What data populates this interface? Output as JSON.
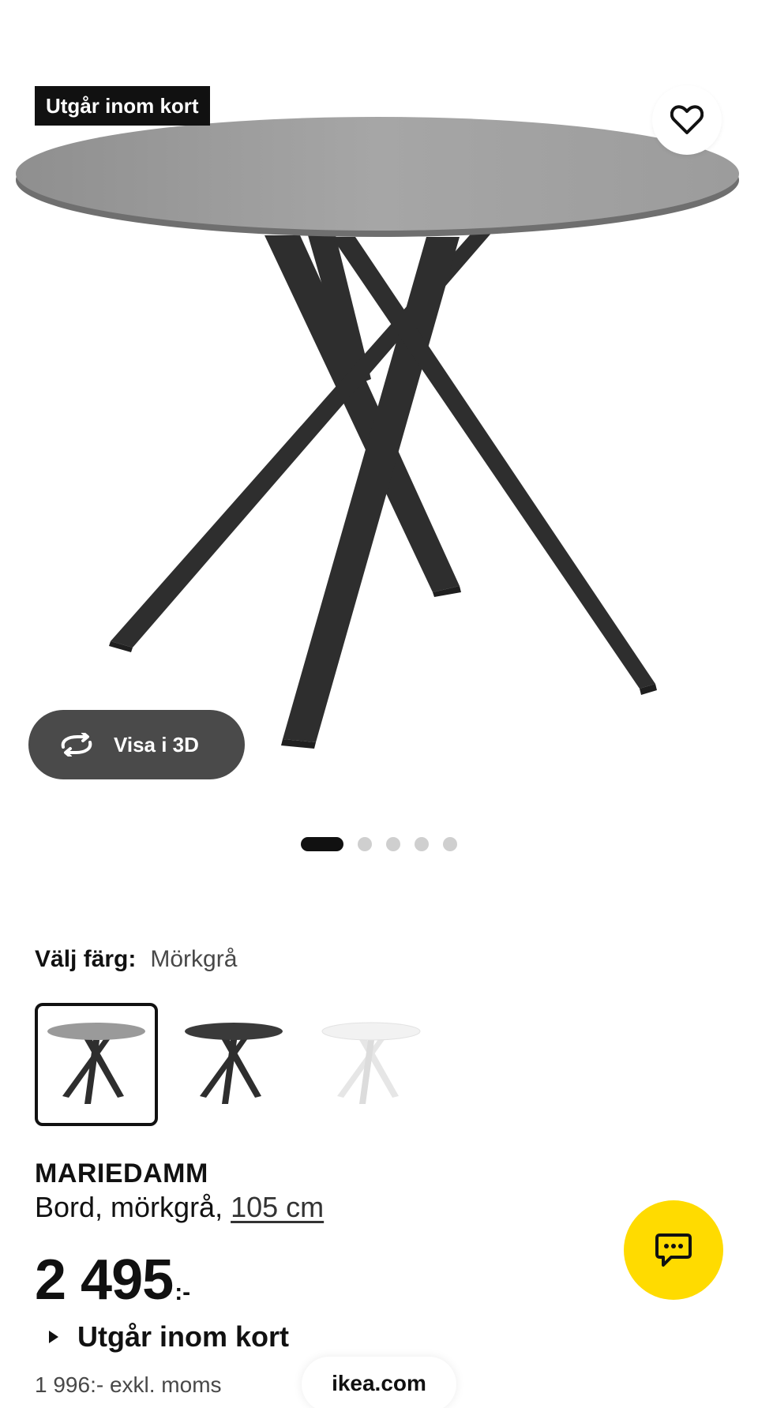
{
  "product_image": {
    "badge": "Utgår inom kort",
    "view_3d_label": "Visa i 3D",
    "carousel": {
      "total": 5,
      "active_index": 0
    }
  },
  "color": {
    "label": "Välj färg:",
    "selected": "Mörkgrå",
    "swatch_colors": [
      "#9a9a9a",
      "#3a3a3a",
      "#f2f2f2"
    ]
  },
  "product": {
    "name": "MARIEDAMM",
    "description": "Bord, mörkgrå, ",
    "size": "105 cm",
    "price": "2 495",
    "price_suffix": ":-",
    "status": "Utgår inom kort",
    "excl_vat": "1 996:- exkl. moms"
  },
  "browser": {
    "url": "ikea.com"
  },
  "colors": {
    "accent": "#ffdb00",
    "dark": "#111111",
    "button_gray": "#4a4a4a"
  }
}
